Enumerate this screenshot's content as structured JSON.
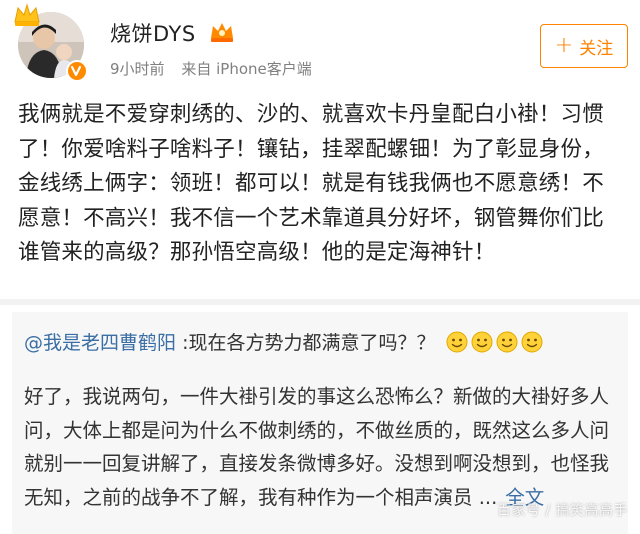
{
  "user": {
    "name": "烧饼DYS",
    "time": "9小时前",
    "source_prefix": "来自",
    "source_device": "iPhone客户端"
  },
  "follow": {
    "label": "关注"
  },
  "post": {
    "text": "我俩就是不爱穿刺绣的、沙的、就喜欢卡丹皇配白小褂！习惯了！你爱啥料子啥料子！镶钻，挂翠配螺钿！为了彰显身份，金线绣上俩字：领班！都可以！就是有钱我俩也不愿意绣！不愿意！不高兴！我不信一个艺术靠道具分好坏，钢管舞你们比谁管来的高级？那孙悟空高级！他的是定海神针！"
  },
  "repost": {
    "mention": "@我是老四曹鹤阳",
    "text": ":现在各方势力都满意了吗？？",
    "quote": "好了，我说两句，一件大褂引发的事这么恐怖么？新做的大褂好多人问，大体上都是问为什么不做刺绣的，不做丝质的，既然这么多人问就别一一回复讲解了，直接发条微博多好。没想到啊没想到，也怪我无知，之前的战争不了解，我有种作为一个相声演员 ...",
    "read_more": "全文"
  },
  "watermark": "百家号 / 搞笑高高手",
  "icons": {
    "crown": "crown-icon",
    "verified": "verified-badge-icon",
    "vip": "vip-crown-icon",
    "emoji": "smile-emoji-icon",
    "plus": "plus-icon"
  },
  "colors": {
    "accent_orange": "#ff8200",
    "link_blue": "#3a6ea5",
    "meta_gray": "#808080",
    "repost_bg": "#f7f7f7"
  }
}
